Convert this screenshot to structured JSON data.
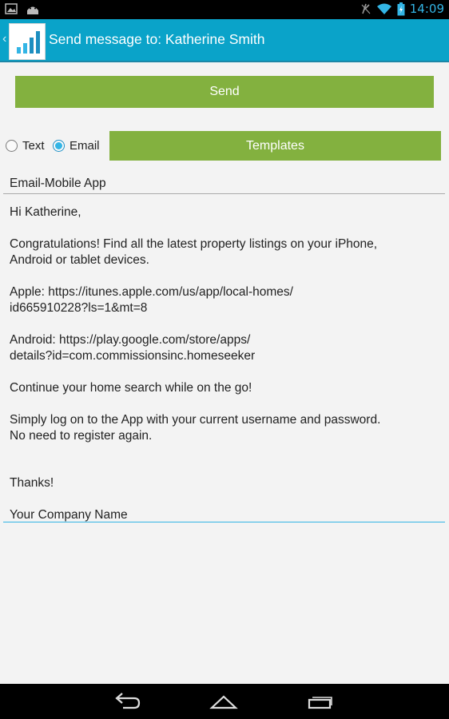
{
  "status_bar": {
    "time": "14:09",
    "left_icons": [
      "gallery-icon",
      "android-icon"
    ],
    "right_icons": [
      "no-sim-icon",
      "wifi-icon",
      "battery-charging-icon"
    ]
  },
  "action_bar": {
    "title": "Send message to: Katherine Smith",
    "up_caret": "‹",
    "logo_icon": "bar-chart-app-logo",
    "color": "#0aa3c9"
  },
  "send_label": "Send",
  "message_type": {
    "options": [
      "Text",
      "Email"
    ],
    "selected": "Email"
  },
  "templates_label": "Templates",
  "subject": "Email-Mobile App",
  "body": {
    "greeting": "Hi Katherine,",
    "para1_line1": "Congratulations! Find all the latest property listings on your iPhone,",
    "para1_line2": "Android or tablet devices.",
    "apple_line1": "Apple: https://itunes.apple.com/us/app/local-homes/",
    "apple_line2": "id665910228?ls=1&mt=8",
    "android_line1": "Android: https://play.google.com/store/apps/",
    "android_line2": "details?id=com.commissionsinc.homeseeker",
    "continue": "Continue your home search while on the go!",
    "login_line1": "Simply log on to the App with your current username and password.",
    "login_line2": "No need to register again.",
    "thanks": "Thanks!",
    "company": "Your Company Name"
  },
  "accent_green": "#83b13f",
  "nav_icons": [
    "back-icon",
    "home-icon",
    "recents-icon"
  ]
}
